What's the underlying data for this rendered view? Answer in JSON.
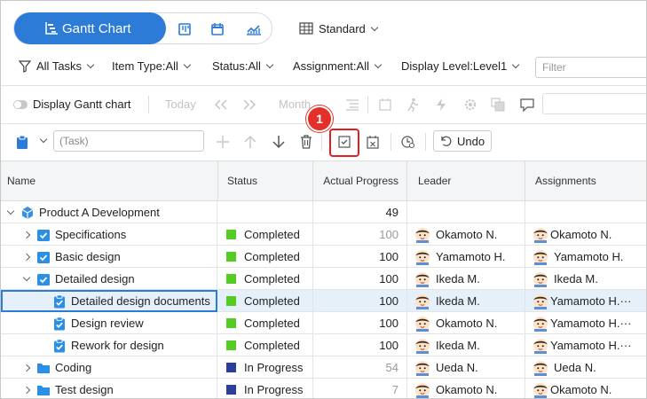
{
  "view_switcher": {
    "active_label": "Gantt Chart",
    "layout_label": "Standard"
  },
  "filters": {
    "all_tasks": "All Tasks",
    "item_type": "Item Type:All",
    "status": "Status:All",
    "assignment": "Assignment:All",
    "display_level": "Display Level:Level1",
    "filter_placeholder": "Filter"
  },
  "gantt_toolbar": {
    "display_gantt_label": "Display Gantt chart",
    "today_label": "Today",
    "month_label": "Month"
  },
  "task_toolbar": {
    "task_placeholder": "(Task)",
    "undo_label": "Undo",
    "callout_number": "1"
  },
  "grid": {
    "columns": {
      "name": "Name",
      "status": "Status",
      "actual_progress": "Actual Progress",
      "leader": "Leader",
      "assignments": "Assignments"
    },
    "rows": [
      {
        "name": "Product A Development",
        "status": "",
        "progress": "49",
        "leader": "",
        "assignments": ""
      },
      {
        "name": "Specifications",
        "status": "Completed",
        "progress": "100",
        "leader": "Okamoto N.",
        "assignments": "Okamoto N."
      },
      {
        "name": "Basic design",
        "status": "Completed",
        "progress": "100",
        "leader": "Yamamoto H.",
        "assignments": "Yamamoto H."
      },
      {
        "name": "Detailed design",
        "status": "Completed",
        "progress": "100",
        "leader": "Ikeda M.",
        "assignments": "Ikeda M."
      },
      {
        "name": "Detailed design documents",
        "status": "Completed",
        "progress": "100",
        "leader": "Ikeda M.",
        "assignments": "Yamamoto H.···"
      },
      {
        "name": "Design review",
        "status": "Completed",
        "progress": "100",
        "leader": "Okamoto N.",
        "assignments": "Yamamoto H.···"
      },
      {
        "name": "Rework for design",
        "status": "Completed",
        "progress": "100",
        "leader": "Ikeda M.",
        "assignments": "Yamamoto H.···"
      },
      {
        "name": "Coding",
        "status": "In Progress",
        "progress": "54",
        "leader": "Ueda N.",
        "assignments": "Ueda N."
      },
      {
        "name": "Test design",
        "status": "In Progress",
        "progress": "7",
        "leader": "Okamoto N.",
        "assignments": "Okamoto N."
      }
    ]
  },
  "colors": {
    "accent": "#2c7bd6",
    "completed": "#55cc22",
    "in_progress": "#2a3f9a",
    "callout": "#e43028"
  }
}
